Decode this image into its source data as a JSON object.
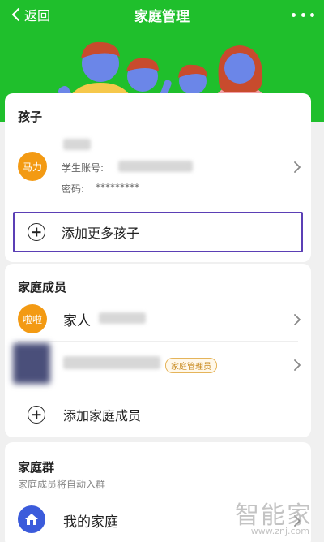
{
  "nav": {
    "back_label": "返回",
    "title": "家庭管理",
    "more_icon": "more-dots-icon"
  },
  "children": {
    "title": "孩子",
    "child": {
      "avatar_text": "马力",
      "student_account_label": "学生账号:",
      "password_label": "密码:",
      "password_value": "*********"
    },
    "add_label": "添加更多孩子"
  },
  "family": {
    "title": "家庭成员",
    "members": [
      {
        "avatar_text": "啦啦",
        "name": "家人"
      },
      {
        "badge": "家庭管理员"
      }
    ],
    "add_label": "添加家庭成员"
  },
  "group": {
    "title": "家庭群",
    "subtitle": "家庭成员将自动入群",
    "item_name": "我的家庭",
    "item_icon": "home-icon"
  },
  "watermark": {
    "big": "智能家",
    "small": "www.znj.com"
  },
  "colors": {
    "header": "#1fbf2c",
    "avatar": "#f39a13",
    "outline": "#5b3fb5",
    "group_icon": "#3b5bdb"
  }
}
